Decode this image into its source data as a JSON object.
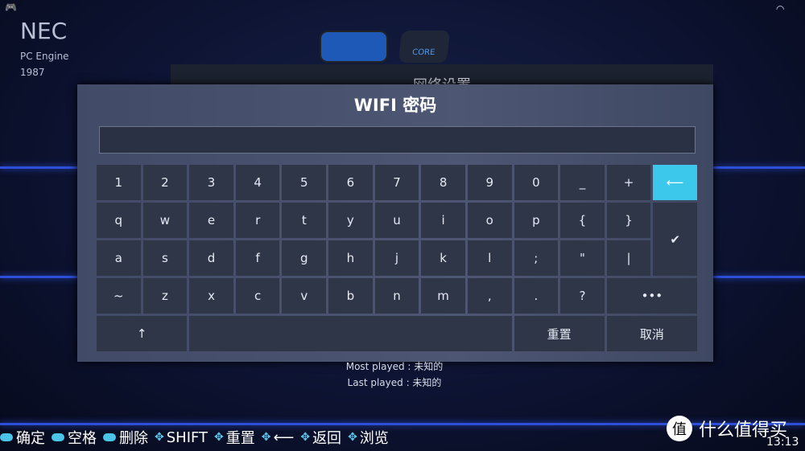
{
  "status": {
    "gamepad_icon": "gamepad-icon",
    "wifi_icon": "wifi-icon",
    "clock": "13:13"
  },
  "system": {
    "name": "NEC",
    "full": "PC Engine",
    "year": "1987"
  },
  "carousel": {
    "cart2_label": "CORE"
  },
  "background_menu": {
    "title": "网络设置"
  },
  "dialog": {
    "title": "WIFI 密码",
    "password_value": "",
    "rows": [
      [
        "1",
        "2",
        "3",
        "4",
        "5",
        "6",
        "7",
        "8",
        "9",
        "0",
        "_",
        "+"
      ],
      [
        "q",
        "w",
        "e",
        "r",
        "t",
        "y",
        "u",
        "i",
        "o",
        "p",
        "{",
        "}"
      ],
      [
        "a",
        "s",
        "d",
        "f",
        "g",
        "h",
        "j",
        "k",
        "l",
        ";",
        "\"",
        "|"
      ],
      [
        "~",
        "z",
        "x",
        "c",
        "v",
        "b",
        "n",
        "m",
        ",",
        ".",
        "?"
      ]
    ],
    "backspace": "⟵",
    "enter": "✔",
    "more": "•••",
    "shift": "↑",
    "space": "",
    "reset": "重置",
    "cancel": "取消",
    "accent": "#3cc8ea"
  },
  "info": {
    "most_played": "Most played : 未知的",
    "last_played": "Last played : 未知的"
  },
  "help": [
    {
      "icon": "start-button-icon",
      "label": "确定"
    },
    {
      "icon": "r-button-icon",
      "label": "空格"
    },
    {
      "icon": "l-button-icon",
      "label": "删除"
    },
    {
      "icon": "dpad-icon",
      "label": "SHIFT"
    },
    {
      "icon": "dpad-icon",
      "label": "重置"
    },
    {
      "icon": "dpad-icon",
      "label": "⟵"
    },
    {
      "icon": "dpad-icon",
      "label": "返回"
    },
    {
      "icon": "dpad-icon",
      "label": "浏览"
    }
  ],
  "watermark": {
    "icon_char": "值",
    "text": "什么值得买"
  }
}
